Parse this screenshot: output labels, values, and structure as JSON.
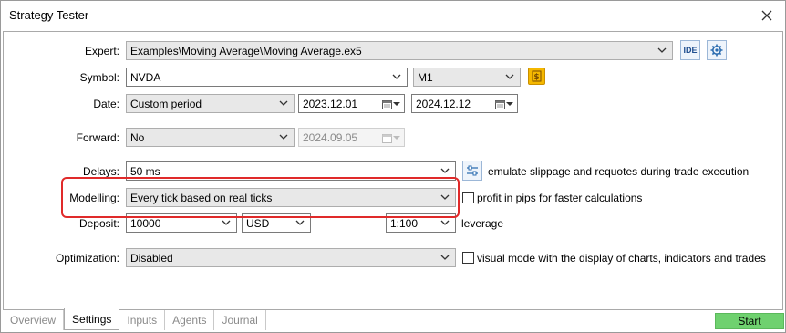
{
  "window": {
    "title": "Strategy Tester"
  },
  "fields": {
    "expert": {
      "label": "Expert:",
      "value": "Examples\\Moving Average\\Moving Average.ex5",
      "ide_label": "IDE"
    },
    "symbol": {
      "label": "Symbol:",
      "value": "NVDA",
      "timeframe": "M1",
      "symbol_icon": "dollar-icon"
    },
    "date": {
      "label": "Date:",
      "period": "Custom period",
      "from": "2023.12.01",
      "to": "2024.12.12"
    },
    "forward": {
      "label": "Forward:",
      "value": "No",
      "date": "2024.09.05"
    },
    "delays": {
      "label": "Delays:",
      "value": "50 ms",
      "emulate_text": "emulate slippage and requotes during trade execution"
    },
    "modelling": {
      "label": "Modelling:",
      "value": "Every tick based on real ticks",
      "pips_text": "profit in pips for faster calculations"
    },
    "deposit": {
      "label": "Deposit:",
      "amount": "10000",
      "currency": "USD",
      "leverage": "1:100",
      "leverage_label": "leverage"
    },
    "optimization": {
      "label": "Optimization:",
      "value": "Disabled",
      "visual_text": "visual mode with the display of charts, indicators and trades"
    }
  },
  "tabs": [
    "Overview",
    "Settings",
    "Inputs",
    "Agents",
    "Journal"
  ],
  "active_tab": "Settings",
  "start_button": "Start",
  "colors": {
    "start_green": "#6fd16f",
    "highlight_red": "#e02a2a"
  }
}
